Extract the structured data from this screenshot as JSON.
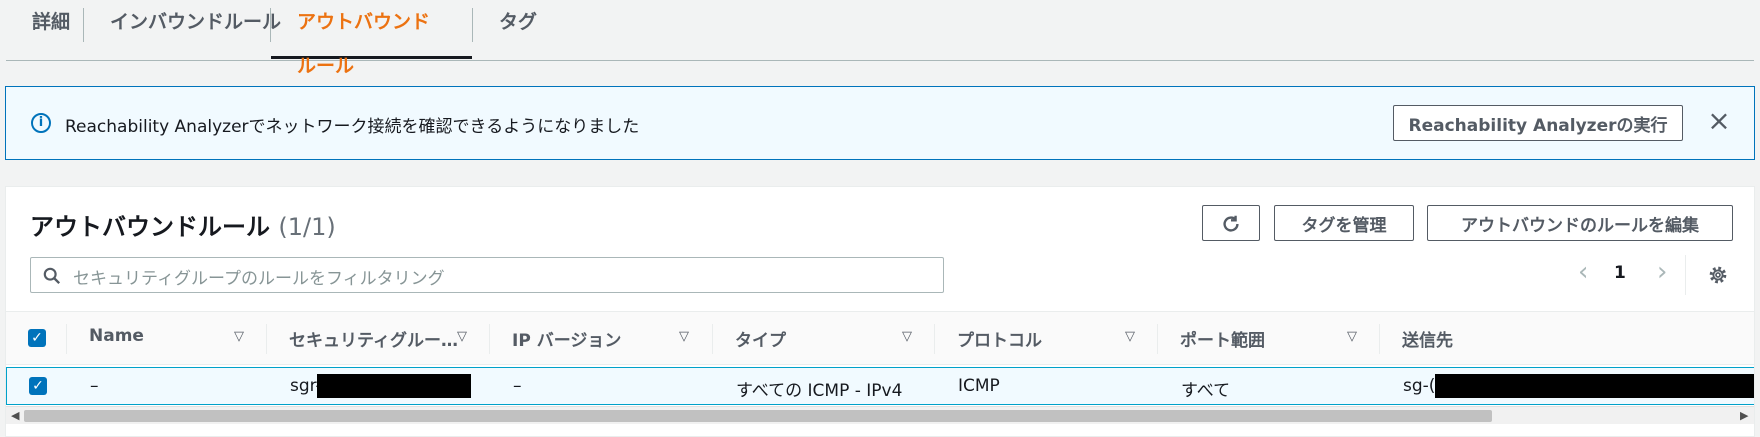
{
  "tabs": [
    {
      "label": "詳細",
      "active": false
    },
    {
      "label": "インバウンドルール",
      "active": false
    },
    {
      "label": "アウトバウンドルール",
      "active": true
    },
    {
      "label": "タグ",
      "active": false
    }
  ],
  "banner": {
    "message": "Reachability Analyzerでネットワーク接続を確認できるようになりました",
    "run_button": "Reachability Analyzerの実行",
    "close_icon": "close-icon"
  },
  "panel": {
    "title": "アウトバウンドルール",
    "count": "(1/1)",
    "refresh_icon": "refresh-icon",
    "manage_tags_button": "タグを管理",
    "edit_rules_button": "アウトバウンドのルールを編集",
    "search_placeholder": "セキュリティグループのルールをフィルタリング",
    "page_number": "1"
  },
  "table": {
    "columns": [
      "Name",
      "セキュリティグルー…",
      "IP バージョン",
      "タイプ",
      "プロトコル",
      "ポート範囲",
      "送信先"
    ],
    "rows": [
      {
        "selected": true,
        "name": "–",
        "sg_rule_id": "sgr-",
        "ip_version": "–",
        "type": "すべての ICMP - IPv4",
        "protocol": "ICMP",
        "port_range": "すべて",
        "destination": "sg-("
      }
    ]
  },
  "colors": {
    "accent": "#ec7211",
    "info_blue": "#0073bb",
    "checkbox": "#0073bb"
  }
}
